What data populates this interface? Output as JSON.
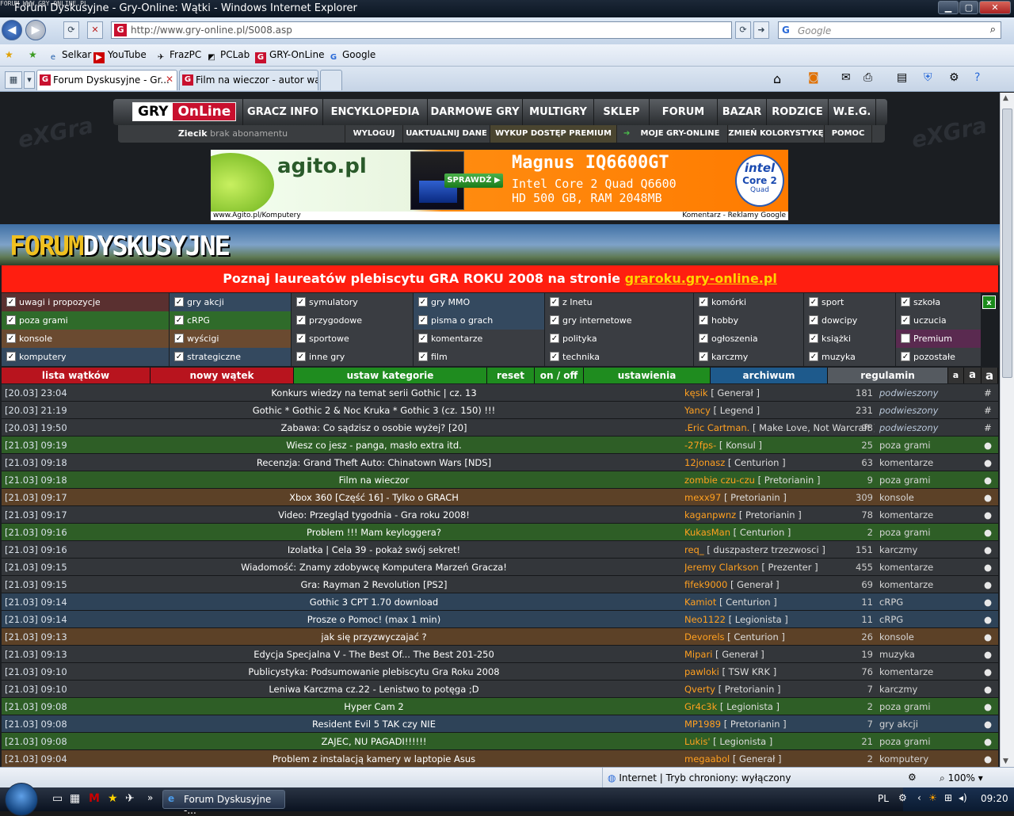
{
  "watermark": "FORUM WWW.GRY-ONLINE.PL",
  "window": {
    "title": "Forum Dyskusyjne - Gry-Online: Wątki - Windows Internet Explorer",
    "min": "▁",
    "max": "▢",
    "close": "✕"
  },
  "browser": {
    "url": "http://www.gry-online.pl/S008.asp",
    "search_placeholder": "Google",
    "favorites": [
      "Selkar",
      "YouTube",
      "FrazPC",
      "PCLab",
      "GRY-OnLine",
      "Google"
    ],
    "tabs": [
      "Forum Dyskusyjne - Gr...",
      "Film na wieczor - autor wą..."
    ],
    "status_zone": "Internet | Tryb chroniony: wyłączony",
    "zoom": "100%"
  },
  "site": {
    "logo_gry": "GRY",
    "logo_online": "OnLine",
    "main_nav": [
      "GRACZ INFO",
      "ENCYKLOPEDIA",
      "DARMOWE GRY",
      "MULTIGRY",
      "SKLEP",
      "FORUM",
      "BAZAR",
      "RODZICE",
      "W.E.G."
    ],
    "user_name": "Ziecik",
    "user_sub": "brak abonamentu",
    "sub_nav": [
      "WYLOGUJ",
      "UAKTUALNIJ DANE",
      "WYKUP DOSTĘP PREMIUM",
      "MOJE GRY-ONLINE",
      "ZMIEŃ KOLORYSTYKĘ",
      "POMOC"
    ],
    "banner": {
      "brand": "agito.pl",
      "cta": "SPRAWDŹ ▶",
      "headline": "Magnus IQ6600GT",
      "line1": "Intel Core 2 Quad Q6600",
      "line2": "HD 500 GB, RAM 2048MB",
      "intel": "intel",
      "intel_sub": "Core 2",
      "intel_sub2": "Quad",
      "foot_left": "www.Agito.pl/Komputery",
      "foot_right": "Komentarz - Reklamy Google"
    },
    "forum_head_1": "FORUM",
    "forum_head_2": "DYSKUSYJNE",
    "promo_text": "Poznaj laureatów plebiscytu GRA ROKU 2008 na stronie ",
    "promo_link": "graroku.gry-online.pl"
  },
  "categories": [
    [
      "uwagi i propozycje",
      "gry akcji",
      "symulatory",
      "gry MMO",
      "z Inetu",
      "komórki",
      "sport",
      "szkoła"
    ],
    [
      "poza grami",
      "cRPG",
      "przygodowe",
      "pisma o grach",
      "gry internetowe",
      "hobby",
      "dowcipy",
      "uczucia"
    ],
    [
      "konsole",
      "wyścigi",
      "sportowe",
      "komentarze",
      "polityka",
      "ogłoszenia",
      "książki",
      "Premium"
    ],
    [
      "komputery",
      "strategiczne",
      "inne gry",
      "film",
      "technika",
      "karczmy",
      "muzyka",
      "pozostałe"
    ]
  ],
  "close_filter": "x",
  "actions": [
    "lista wątków",
    "nowy wątek",
    "ustaw kategorie",
    "reset",
    "on / off",
    "ustawienia",
    "archiwum",
    "regulamin",
    "a",
    "a",
    "a"
  ],
  "threads": [
    {
      "date": "[20.03] 23:04",
      "title": "Konkurs wiedzy na temat serii Gothic | cz. 13",
      "user": "kęsik",
      "rank": " [ Generał ]",
      "count": "181",
      "cat": "podwieszony",
      "mark": "#"
    },
    {
      "date": "[20.03] 21:19",
      "title": "Gothic * Gothic 2 & Noc Kruka * Gothic 3 (cz. 150) !!!",
      "user": "Yancy",
      "rank": " [ Legend ]",
      "count": "231",
      "cat": "podwieszony",
      "mark": "#"
    },
    {
      "date": "[20.03] 19:50",
      "title": "Zabawa: Co sądzisz o osobie wyżej? [20]",
      "user": ".Eric Cartman.",
      "rank": " [ Make Love, Not Warcraft ]",
      "count": "98",
      "cat": "podwieszony",
      "mark": "#"
    },
    {
      "date": "[21.03] 09:19",
      "title": "Wiesz co jesz - panga, masło extra itd.",
      "user": "-27fps-",
      "rank": " [ Konsul ]",
      "count": "25",
      "cat": "poza grami",
      "mark": "●"
    },
    {
      "date": "[21.03] 09:18",
      "title": "Recenzja: Grand Theft Auto: Chinatown Wars [NDS]",
      "user": "12jonasz",
      "rank": " [ Centurion ]",
      "count": "63",
      "cat": "komentarze",
      "mark": "●"
    },
    {
      "date": "[21.03] 09:18",
      "title": "Film na wieczor",
      "user": "zombie czu-czu",
      "rank": " [ Pretorianin ]",
      "count": "9",
      "cat": "poza grami",
      "mark": "●"
    },
    {
      "date": "[21.03] 09:17",
      "title": "Xbox 360 [Część 16] - Tylko o GRACH",
      "user": "mexx97",
      "rank": " [ Pretorianin ]",
      "count": "309",
      "cat": "konsole",
      "mark": "●"
    },
    {
      "date": "[21.03] 09:17",
      "title": "Video: Przegląd tygodnia - Gra roku 2008!",
      "user": "kaganpwnz",
      "rank": " [ Pretorianin ]",
      "count": "78",
      "cat": "komentarze",
      "mark": "●"
    },
    {
      "date": "[21.03] 09:16",
      "title": "Problem !!! Mam keyloggera?",
      "user": "KukasMan",
      "rank": " [ Centurion ]",
      "count": "2",
      "cat": "poza grami",
      "mark": "●"
    },
    {
      "date": "[21.03] 09:16",
      "title": "Izolatka | Cela 39 - pokaż swój sekret!",
      "user": "req_",
      "rank": " [ duszpasterz trzezwosci ]",
      "count": "151",
      "cat": "karczmy",
      "mark": "●"
    },
    {
      "date": "[21.03] 09:15",
      "title": "Wiadomość: Znamy zdobywcę Komputera Marzeń Gracza!",
      "user": "Jeremy Clarkson",
      "rank": " [ Prezenter ]",
      "count": "455",
      "cat": "komentarze",
      "mark": "●"
    },
    {
      "date": "[21.03] 09:15",
      "title": "Gra: Rayman 2 Revolution [PS2]",
      "user": "fifek9000",
      "rank": " [ Generał ]",
      "count": "69",
      "cat": "komentarze",
      "mark": "●"
    },
    {
      "date": "[21.03] 09:14",
      "title": "Gothic 3 CPT 1.70 download",
      "user": "Kamiot",
      "rank": " [ Centurion ]",
      "count": "11",
      "cat": "cRPG",
      "mark": "●"
    },
    {
      "date": "[21.03] 09:14",
      "title": "Prosze o Pomoc! (max 1 min)",
      "user": "Neo1122",
      "rank": " [ Legionista ]",
      "count": "11",
      "cat": "cRPG",
      "mark": "●"
    },
    {
      "date": "[21.03] 09:13",
      "title": "jak się przyzwyczajać ?",
      "user": "Devorels",
      "rank": " [ Centurion ]",
      "count": "26",
      "cat": "konsole",
      "mark": "●"
    },
    {
      "date": "[21.03] 09:13",
      "title": "Edycja Specjalna V - The Best Of... The Best 201-250",
      "user": "Mipari",
      "rank": " [ Generał ]",
      "count": "19",
      "cat": "muzyka",
      "mark": "●"
    },
    {
      "date": "[21.03] 09:10",
      "title": "Publicystyka: Podsumowanie plebiscytu Gra Roku 2008",
      "user": "pawloki",
      "rank": " [ TSW KRK ]",
      "count": "76",
      "cat": "komentarze",
      "mark": "●"
    },
    {
      "date": "[21.03] 09:10",
      "title": "Leniwa Karczma cz.22 - Lenistwo to potęga ;D",
      "user": "Qverty",
      "rank": " [ Pretorianin ]",
      "count": "7",
      "cat": "karczmy",
      "mark": "●"
    },
    {
      "date": "[21.03] 09:08",
      "title": "Hyper Cam 2",
      "user": "Gr4c3k",
      "rank": " [ Legionista ]",
      "count": "2",
      "cat": "poza grami",
      "mark": "●"
    },
    {
      "date": "[21.03] 09:08",
      "title": "Resident Evil 5 TAK czy NIE",
      "user": "MP1989",
      "rank": " [ Pretorianin ]",
      "count": "7",
      "cat": "gry akcji",
      "mark": "●"
    },
    {
      "date": "[21.03] 09:08",
      "title": "ZAJEC, NU PAGADI!!!!!!",
      "user": "Lukis'",
      "rank": " [ Legionista ]",
      "count": "21",
      "cat": "poza grami",
      "mark": "●"
    },
    {
      "date": "[21.03] 09:04",
      "title": "Problem z instalacją kamery w laptopie Asus",
      "user": "megaabol",
      "rank": " [ Generał ]",
      "count": "2",
      "cat": "komputery",
      "mark": "●"
    }
  ],
  "taskbar": {
    "window_label": "Forum Dyskusyjne -...",
    "lang": "PL",
    "time": "09:20"
  },
  "colors": {
    "cat_green": "#2f6b2a",
    "cat_blue": "#34495f",
    "cat_brown": "#6a4a30",
    "cat_grey": "#3a3d42",
    "cat_maroon": "#5a3030",
    "row_green": "#2e5e26",
    "row_blue": "#2e4358",
    "row_brown": "#5c4127",
    "row_grey": "#33363a"
  }
}
